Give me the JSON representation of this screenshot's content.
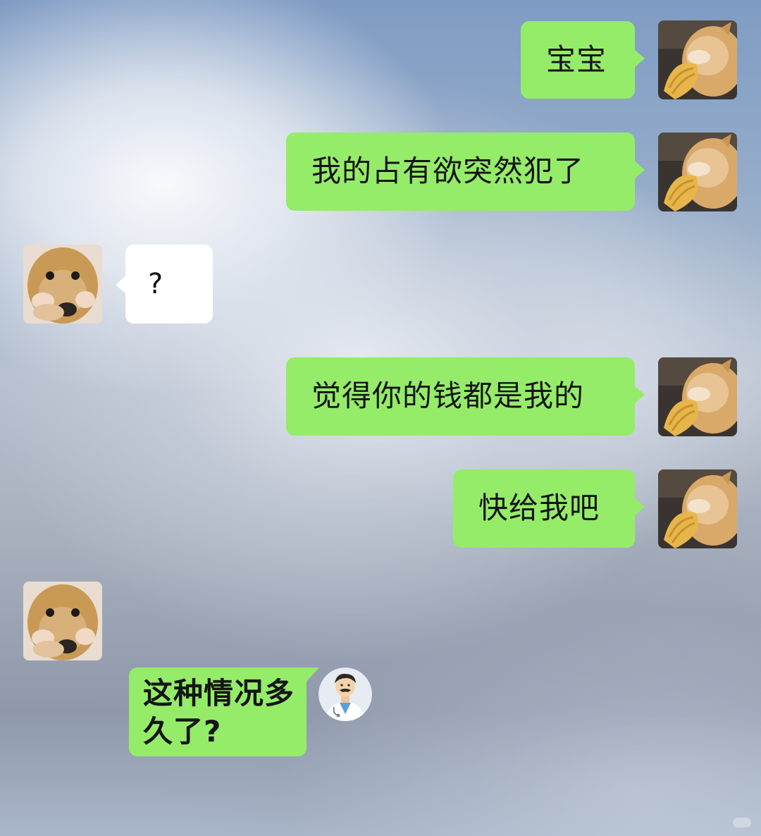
{
  "chat": {
    "messages": [
      {
        "sender": "me",
        "text": "宝宝"
      },
      {
        "sender": "me",
        "text": "我的占有欲突然犯了"
      },
      {
        "sender": "other",
        "text": "?"
      },
      {
        "sender": "me",
        "text": "觉得你的钱都是我的"
      },
      {
        "sender": "me",
        "text": "快给我吧"
      },
      {
        "sender": "other",
        "text": "这种情况多久了?",
        "lines": [
          "这种情况多",
          "久了?"
        ]
      }
    ]
  },
  "avatars": {
    "me": "cat-avatar-icon",
    "other": "dog-avatar-icon",
    "sticker": "doctor-icon"
  },
  "colors": {
    "bubble_green": "#95ec69",
    "bubble_white": "#ffffff",
    "text": "#141414"
  }
}
